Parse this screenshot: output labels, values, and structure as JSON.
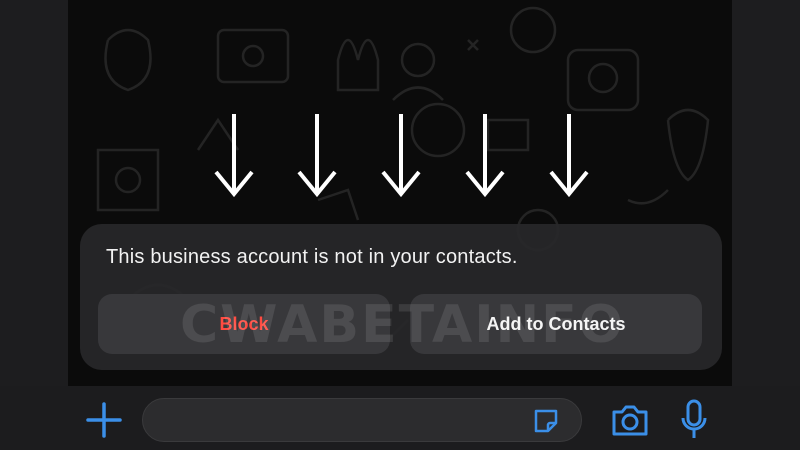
{
  "banner": {
    "message": "This business account is not in your contacts.",
    "block_label": "Block",
    "add_label": "Add to Contacts"
  },
  "watermark": {
    "text": "CWABETAINFO"
  },
  "annotation": {
    "arrow_count": 5,
    "arrow_icon": "down-arrow-icon"
  },
  "input_bar": {
    "plus_icon": "plus-icon",
    "sticker_icon": "sticker-icon",
    "camera_icon": "camera-icon",
    "mic_icon": "microphone-icon"
  },
  "colors": {
    "accent": "#3b8fe8",
    "block_red": "#ff4b41",
    "banner_bg": "#28282a",
    "button_bg": "#38383b"
  }
}
